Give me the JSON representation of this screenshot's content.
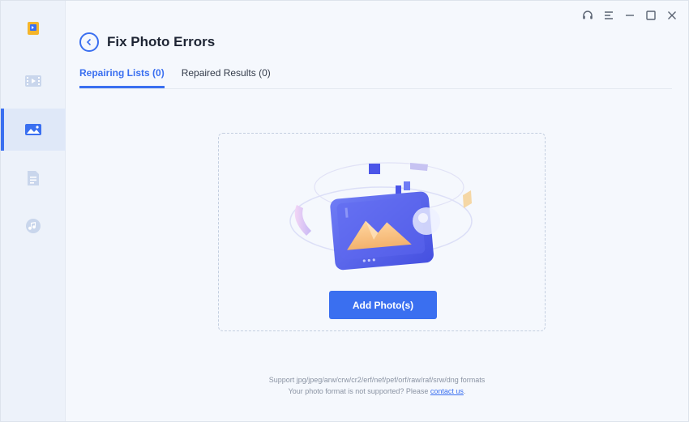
{
  "sidebar": {
    "items": [
      {
        "icon": "app-logo-icon"
      },
      {
        "icon": "video-icon"
      },
      {
        "icon": "photo-icon",
        "active": true
      },
      {
        "icon": "document-icon"
      },
      {
        "icon": "music-icon"
      }
    ]
  },
  "titlebar": {
    "buttons": [
      "headset-icon",
      "menu-icon",
      "minimize-icon",
      "maximize-icon",
      "close-icon"
    ]
  },
  "header": {
    "title": "Fix Photo Errors"
  },
  "tabs": [
    {
      "label": "Repairing Lists (0)",
      "active": true
    },
    {
      "label": "Repaired Results (0)",
      "active": false
    }
  ],
  "dropzone": {
    "button_label": "Add Photo(s)"
  },
  "footer": {
    "formats_text": "Support jpg/jpeg/arw/crw/cr2/erf/nef/pef/orf/raw/raf/srw/dng formats",
    "unsupported_text": "Your photo format is not supported? Please ",
    "link_text": "contact us",
    "after_link": "."
  },
  "colors": {
    "accent": "#3a6ff0",
    "background": "#f5f8fd",
    "sidebar": "#edf2fa"
  }
}
